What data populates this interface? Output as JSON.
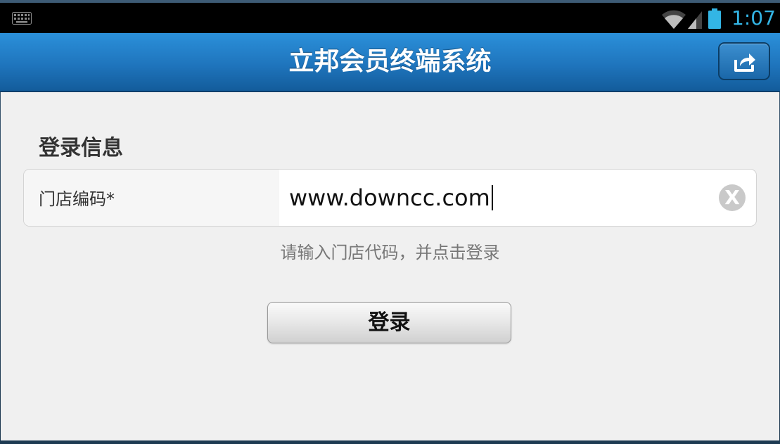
{
  "status_bar": {
    "time": "1:07",
    "icons": [
      "keyboard-icon",
      "wifi-icon",
      "signal-icon",
      "battery-icon"
    ],
    "clock_color": "#33b5e5"
  },
  "header": {
    "title": "立邦会员终端系统",
    "share_icon": "share-icon",
    "bar_color": "#1f75bd"
  },
  "login_form": {
    "section_title": "登录信息",
    "store_code_label": "门店编码*",
    "store_code_value": "www.downcc.com",
    "clear_label": "X",
    "hint": "请输入门店代码，并点击登录",
    "login_button_label": "登录"
  }
}
